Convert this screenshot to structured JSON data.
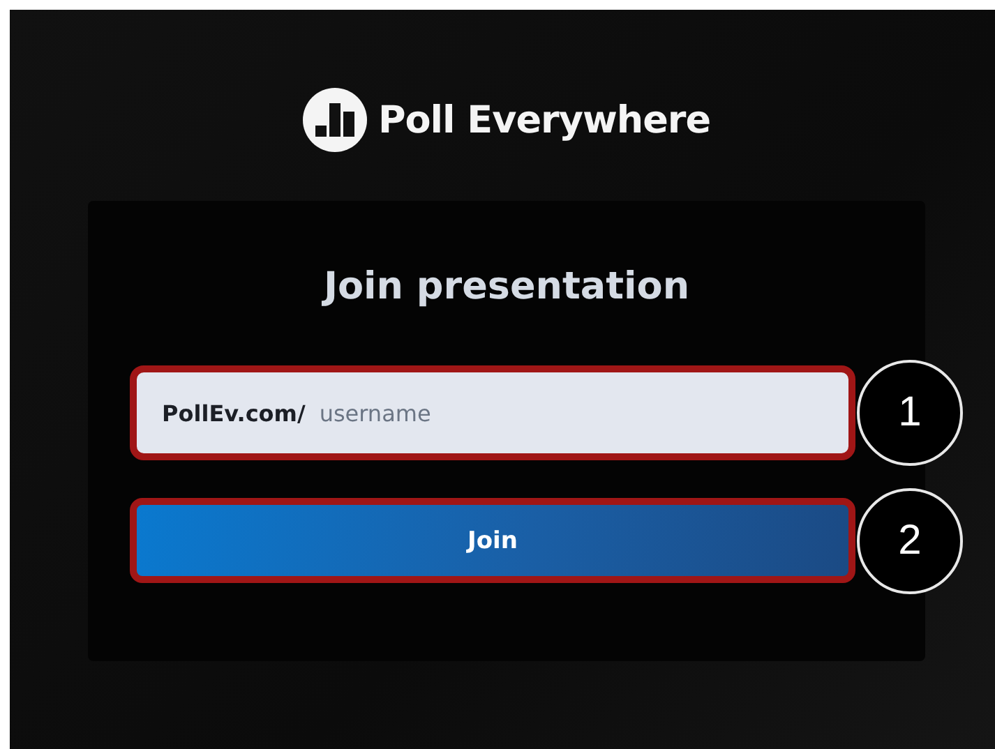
{
  "logo": {
    "text": "Poll Everywhere"
  },
  "card": {
    "title": "Join presentation",
    "field": {
      "prefix": "PollEv.com/",
      "placeholder": "username",
      "callout": "1"
    },
    "button": {
      "label": "Join",
      "callout": "2"
    }
  }
}
